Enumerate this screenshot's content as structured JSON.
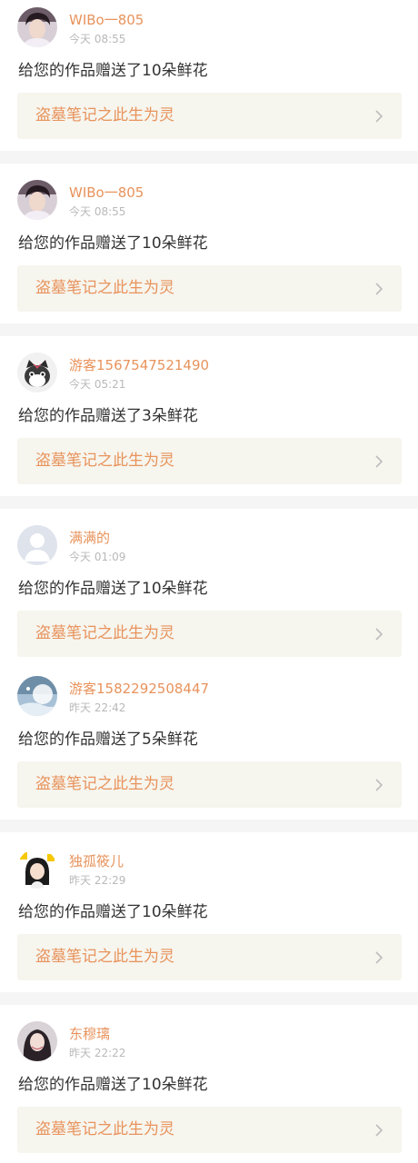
{
  "notifications": [
    {
      "username": "WIBo一805",
      "time": "今天 08:55",
      "message": "给您的作品赠送了10朵鲜花",
      "work_title": "盗墓笔记之此生为灵",
      "avatar": "young-man-photo"
    },
    {
      "username": "WIBo一805",
      "time": "今天 08:55",
      "message": "给您的作品赠送了10朵鲜花",
      "work_title": "盗墓笔记之此生为灵",
      "avatar": "young-man-photo"
    },
    {
      "username": "游客1567547521490",
      "time": "今天 05:21",
      "message": "给您的作品赠送了3朵鲜花",
      "work_title": "盗墓笔记之此生为灵",
      "avatar": "cartoon-cat"
    },
    {
      "username": "满满的",
      "time": "今天 01:09",
      "message": "给您的作品赠送了10朵鲜花",
      "work_title": "盗墓笔记之此生为灵",
      "avatar": "default-user"
    },
    {
      "username": "游客1582292508447",
      "time": "昨天 22:42",
      "message": "给您的作品赠送了5朵鲜花",
      "work_title": "盗墓笔记之此生为灵",
      "avatar": "winter-scene"
    },
    {
      "username": "独孤筱儿",
      "time": "昨天 22:29",
      "message": "给您的作品赠送了10朵鲜花",
      "work_title": "盗墓笔记之此生为灵",
      "avatar": "cartoon-girl"
    },
    {
      "username": "东穆璃",
      "time": "昨天 22:22",
      "message": "给您的作品赠送了10朵鲜花",
      "work_title": "盗墓笔记之此生为灵",
      "avatar": "woman-photo"
    }
  ],
  "colors": {
    "accent": "#e8935c",
    "link_background": "#f6f5ee",
    "time_text": "#b9b9b9",
    "body_text": "#333333",
    "separator": "#f5f5f5"
  },
  "icons": {
    "link_arrow": "chevron-right-icon"
  }
}
